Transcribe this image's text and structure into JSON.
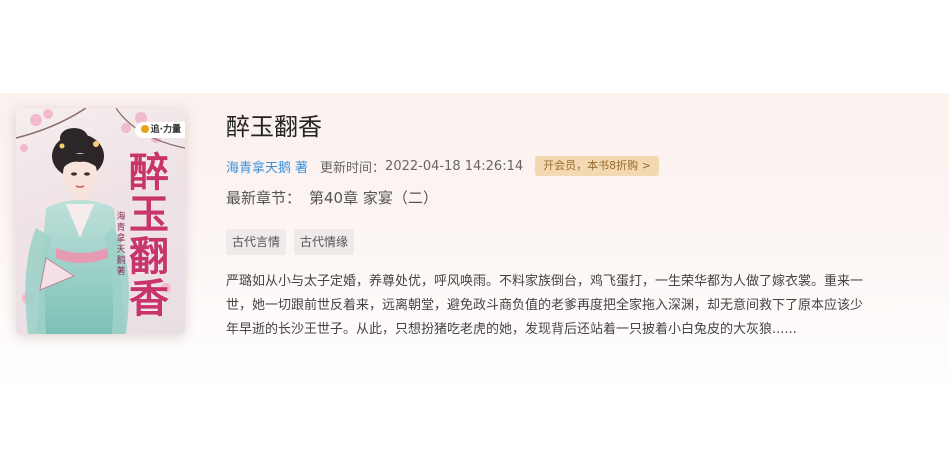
{
  "book": {
    "title": "醉玉翻香",
    "cover": {
      "title_text": "醉玉翻香",
      "author_text": "海青拿天鹅著",
      "brand": "追·力量",
      "accent_color": "#c8356b"
    },
    "author": "海青拿天鹅",
    "author_suffix": "著",
    "update_label": "更新时间：",
    "update_time": "2022-04-18 14:26:14",
    "vip_badge": "开会员，本书8折购 >",
    "latest_label": "最新章节：",
    "latest_chapter": "第40章 家宴（二）",
    "tags": [
      "古代言情",
      "古代情缘"
    ],
    "intro": "严璐如从小与太子定婚，养尊处优，呼风唤雨。不料家族倒台，鸡飞蛋打，一生荣华都为人做了嫁衣裳。重来一世，她一切跟前世反着来，远离朝堂，避免政斗商负值的老爹再度把全家拖入深渊，却无意间救下了原本应该少年早逝的长沙王世子。从此，只想扮猪吃老虎的她，发现背后还站着一只披着小白兔皮的大灰狼......"
  },
  "colors": {
    "link": "#3b8fd8",
    "vip_bg": "#f3d9b1",
    "vip_text": "#9a6a2c",
    "tag_bg": "#efe9e9"
  }
}
